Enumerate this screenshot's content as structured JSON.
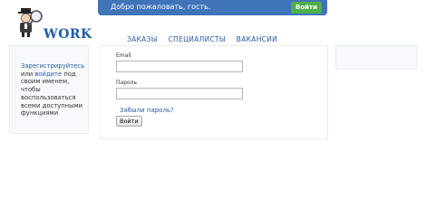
{
  "logo": {
    "text": "WORK"
  },
  "topbar": {
    "welcome": "Добро пожаловать, гость.",
    "login_button": "Войти"
  },
  "nav": {
    "items": [
      "ЗАКАЗЫ",
      "СПЕЦИАЛИСТЫ",
      "ВАКАНСИИ"
    ]
  },
  "login_form": {
    "email_label": "Email",
    "email_value": "",
    "password_label": "Пароль",
    "password_value": "",
    "forgot_link": "Забыли пароль?",
    "submit_button": "Войти"
  },
  "left_panel": {
    "register_link": "Зарегистрируйтесь",
    "or_text": "или",
    "login_link": "войдите",
    "rest_text": "под своим именем, чтобы воспользоваться всеми доступными функциями"
  },
  "colors": {
    "topbar": "#3f74b9",
    "login_button": "#4fb04a",
    "link": "#2a5aa3",
    "logo_text": "#1f5ea8"
  }
}
